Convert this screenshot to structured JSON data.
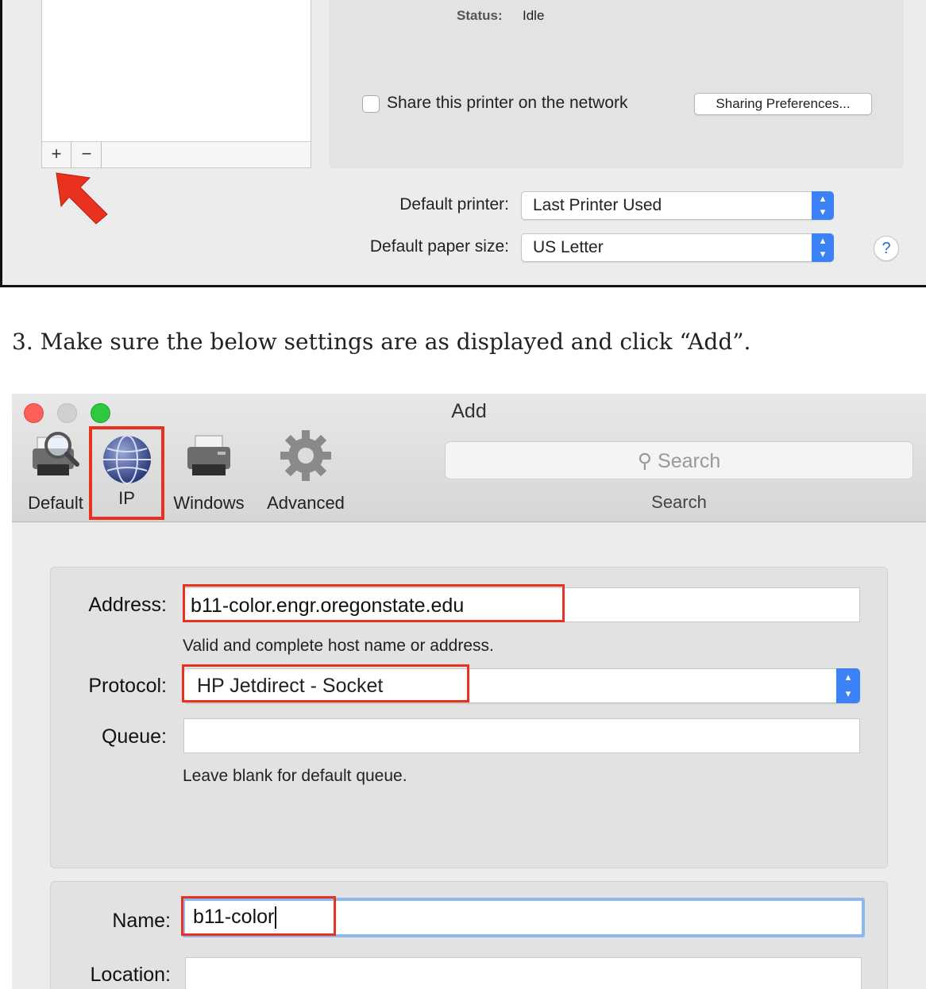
{
  "printers_pane": {
    "plus_label": "+",
    "minus_label": "−",
    "status_label": "Status:",
    "status_value": "Idle",
    "share_label": "Share this printer on the network",
    "sharing_button": "Sharing Preferences...",
    "default_printer_label": "Default printer:",
    "default_printer_value": "Last Printer Used",
    "paper_size_label": "Default paper size:",
    "paper_size_value": "US Letter",
    "help_label": "?"
  },
  "instruction": "3. Make sure the below settings are as displayed and click “Add”.",
  "add_window": {
    "title": "Add",
    "toolbar": [
      {
        "label": "Default",
        "icon": "printer-search-icon"
      },
      {
        "label": "IP",
        "icon": "globe-icon"
      },
      {
        "label": "Windows",
        "icon": "printer-icon"
      },
      {
        "label": "Advanced",
        "icon": "gear-icon"
      }
    ],
    "search_placeholder": "Search",
    "search_caption": "Search",
    "address_label": "Address:",
    "address_value": "b11-color.engr.oregonstate.edu",
    "address_hint": "Valid and complete host name or address.",
    "protocol_label": "Protocol:",
    "protocol_value": "HP Jetdirect - Socket",
    "queue_label": "Queue:",
    "queue_value": "",
    "queue_hint": "Leave blank for default queue.",
    "name_label": "Name:",
    "name_value": "b11-color",
    "location_label": "Location:",
    "location_value": ""
  },
  "colors": {
    "highlight": "#e8321f",
    "accent": "#3b82f6",
    "arrow": "#e8321f"
  }
}
